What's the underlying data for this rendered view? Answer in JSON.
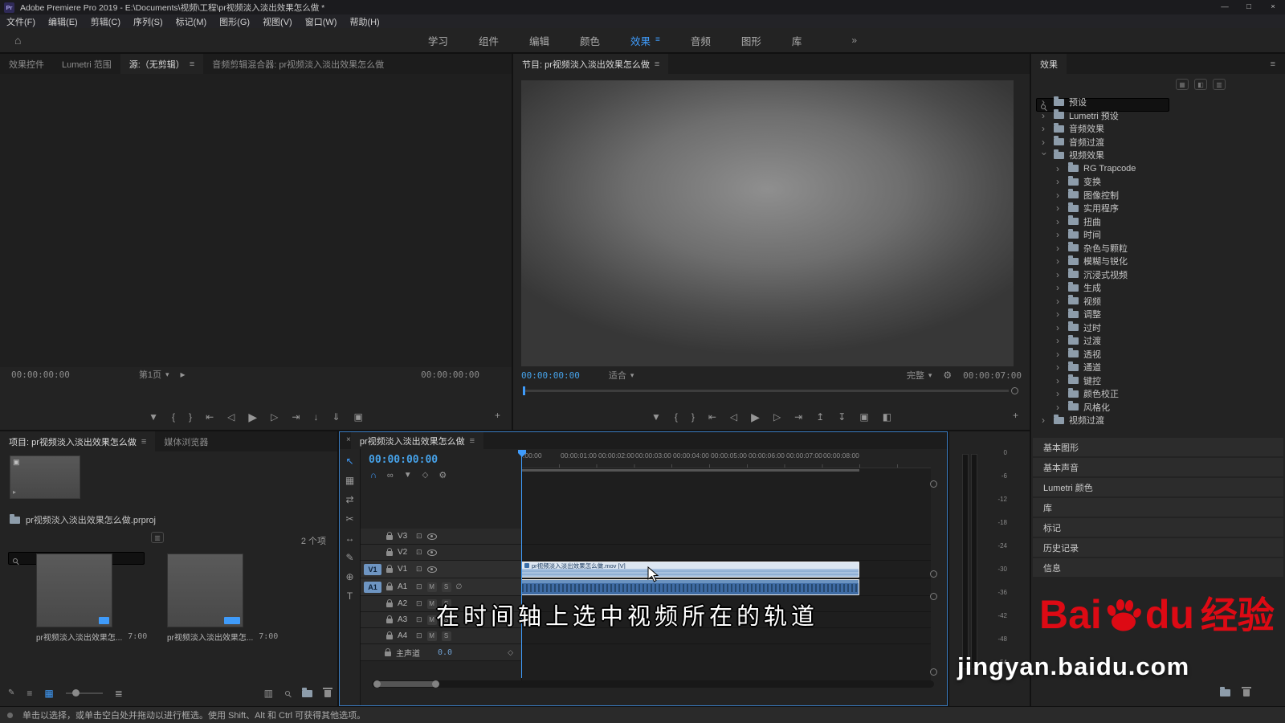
{
  "icons": {
    "menu": "≡",
    "home": "⌂",
    "overflow": "»",
    "chevron": "›",
    "close": "×",
    "dropdown": "▾",
    "plus": "+",
    "wrench": "⚙",
    "marker": "▼",
    "brace_open": "{",
    "brace_close": "}",
    "go_in": "⇤",
    "step_back": "◁",
    "play": "▶",
    "step_fwd": "▷",
    "go_out": "⇥",
    "lift": "↥",
    "extract": "↧",
    "export_frame": "▣",
    "compare": "◧",
    "insert": "↓",
    "overwrite": "⇓",
    "play_small": "▸",
    "snap": "∩",
    "linked": "∞",
    "diamond": "◇",
    "sync": "⊡",
    "mic": "∅",
    "select_tool": "↖",
    "track_select_tool": "▦",
    "ripple_tool": "⇄",
    "razor_tool": "✂",
    "slip_tool": "↔",
    "pen_tool": "✎",
    "hand_tool": "⊕",
    "type_tool": "T",
    "pencil": "✎",
    "list_view": "≡",
    "grid_view": "▦",
    "sort": "≣",
    "badge": "▥",
    "camera": "▣"
  },
  "titlebar": {
    "app_icon": "Pr",
    "title": "Adobe Premiere Pro 2019 - E:\\Documents\\视频\\工程\\pr视频淡入淡出效果怎么做 *",
    "minimize": "—",
    "maximize": "□",
    "close": "×"
  },
  "menubar": {
    "items": [
      "文件(F)",
      "编辑(E)",
      "剪辑(C)",
      "序列(S)",
      "标记(M)",
      "图形(G)",
      "视图(V)",
      "窗口(W)",
      "帮助(H)"
    ]
  },
  "workspace": {
    "tabs": [
      "学习",
      "组件",
      "编辑",
      "颜色",
      "效果",
      "音频",
      "图形",
      "库"
    ]
  },
  "source": {
    "tabs": [
      "效果控件",
      "Lumetri 范围",
      "源:（无剪辑）",
      "音频剪辑混合器: pr视频淡入淡出效果怎么做"
    ],
    "timecode_left": "00:00:00:00",
    "page_label": "第1页",
    "timecode_right": "00:00:00:00"
  },
  "program": {
    "tab": "节目: pr视频淡入淡出效果怎么做",
    "timecode": "00:00:00:00",
    "fit_label": "适合",
    "quality_label": "完整",
    "duration": "00:00:07:00"
  },
  "effects": {
    "title": "效果",
    "items": [
      {
        "label": "预设"
      },
      {
        "label": "Lumetri 预设"
      },
      {
        "label": "音频效果"
      },
      {
        "label": "音频过渡"
      },
      {
        "label": "视频效果"
      },
      {
        "label": "RG Trapcode"
      },
      {
        "label": "变换"
      },
      {
        "label": "图像控制"
      },
      {
        "label": "实用程序"
      },
      {
        "label": "扭曲"
      },
      {
        "label": "时间"
      },
      {
        "label": "杂色与颗粒"
      },
      {
        "label": "模糊与锐化"
      },
      {
        "label": "沉浸式视频"
      },
      {
        "label": "生成"
      },
      {
        "label": "视频"
      },
      {
        "label": "调整"
      },
      {
        "label": "过时"
      },
      {
        "label": "过渡"
      },
      {
        "label": "透视"
      },
      {
        "label": "通道"
      },
      {
        "label": "键控"
      },
      {
        "label": "颜色校正"
      },
      {
        "label": "风格化"
      },
      {
        "label": "视频过渡"
      }
    ],
    "stacked_panels": [
      "基本图形",
      "基本声音",
      "Lumetri 颜色",
      "库",
      "标记",
      "历史记录",
      "信息"
    ]
  },
  "project": {
    "tab_project": "项目: pr视频淡入淡出效果怎么做",
    "tab_media": "媒体浏览器",
    "project_file": "pr视频淡入淡出效果怎么做.prproj",
    "item_count": "2 个项",
    "clips": [
      {
        "name": "pr视频淡入淡出效果怎...",
        "duration": "7:00"
      },
      {
        "name": "pr视频淡入淡出效果怎...",
        "duration": "7:00"
      }
    ]
  },
  "timeline": {
    "tab": "pr视频淡入淡出效果怎么做",
    "timecode": "00:00:00:00",
    "ruler": [
      ":00:00",
      "00:00:01:00",
      "00:00:02:00",
      "00:00:03:00",
      "00:00:04:00",
      "00:00:05:00",
      "00:00:06:00",
      "00:00:07:00",
      "00:00:08:00"
    ],
    "video_tracks": [
      "V3",
      "V2",
      "V1"
    ],
    "audio_tracks": [
      "A1",
      "A2",
      "A3",
      "A4"
    ],
    "mute": "M",
    "solo": "S",
    "master_label": "主声道",
    "master_value": "0.0",
    "clip_label": "pr视频淡入淡出效果怎么做.mov [V]"
  },
  "meters": {
    "scale": [
      "0",
      "-6",
      "-12",
      "-18",
      "-24",
      "-30",
      "-36",
      "-42",
      "-48",
      "-54"
    ]
  },
  "caption": {
    "text": "在时间轴上选中视频所在的轨道"
  },
  "watermark": {
    "bai": "Bai",
    "du": "du",
    "brand": "经验",
    "url": "jingyan.baidu.com"
  },
  "statusbar": {
    "text": "单击以选择，或单击空白处并拖动以进行框选。使用 Shift、Alt 和 Ctrl 可获得其他选项。"
  }
}
